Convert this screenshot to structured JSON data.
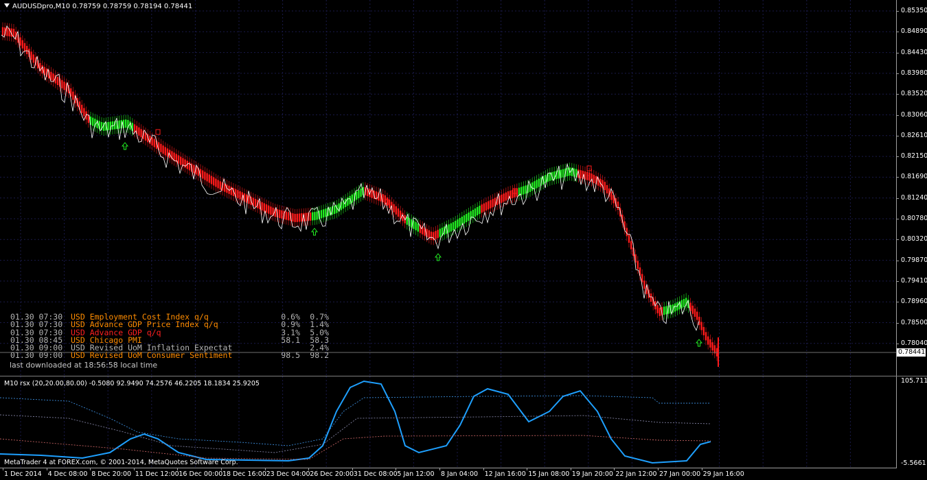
{
  "chart": {
    "symbol_title": "AUDUSDpro,M10  0.78759 0.78759 0.78194 0.78441",
    "current_price": "0.78441",
    "price_axis": [
      "0.85350",
      "0.84890",
      "0.84430",
      "0.83980",
      "0.83520",
      "0.83060",
      "0.82610",
      "0.82150",
      "0.81690",
      "0.81240",
      "0.80780",
      "0.80320",
      "0.79870",
      "0.79410",
      "0.78960",
      "0.78500",
      "0.78040"
    ],
    "time_axis": [
      "1 Dec 2014",
      "4 Dec 08:00",
      "8 Dec 20:00",
      "11 Dec 12:00",
      "16 Dec 00:00",
      "18 Dec 16:00",
      "23 Dec 04:00",
      "26 Dec 20:00",
      "31 Dec 08:00",
      "5 Jan 12:00",
      "8 Jan 04:00",
      "12 Jan 16:00",
      "15 Jan 08:00",
      "19 Jan 20:00",
      "22 Jan 12:00",
      "27 Jan 00:00",
      "29 Jan 16:00"
    ],
    "colors": {
      "background": "#000000",
      "grid": "#1a1a4a",
      "bear": "#ff1a1a",
      "bull": "#22ee22",
      "line": "#ffffff",
      "rsx": "#1ea0ff"
    }
  },
  "news": [
    {
      "time": "01.30 07:30",
      "event": "USD Employment Cost Index q/q",
      "actual": "0.6%",
      "forecast": "0.7%",
      "color": "#ff8c00"
    },
    {
      "time": "01.30 07:30",
      "event": "USD Advance GDP Price Index q/q",
      "actual": "0.9%",
      "forecast": "1.4%",
      "color": "#ff8c00"
    },
    {
      "time": "01.30 07:30",
      "event": "USD Advance GDP q/q",
      "actual": "3.1%",
      "forecast": "5.0%",
      "color": "#ff2020"
    },
    {
      "time": "01.30 08:45",
      "event": "USD Chicago PMI",
      "actual": "58.1",
      "forecast": "58.3",
      "color": "#ff8c00"
    },
    {
      "time": "01.30 09:00",
      "event": "USD Revised UoM Inflation Expectat",
      "actual": "",
      "forecast": "2.4%",
      "color": "#b4b4b4"
    },
    {
      "time": "01.30 09:00",
      "event": "USD Revised UoM Consumer Sentiment",
      "actual": "98.5",
      "forecast": "98.2",
      "color": "#ff8c00"
    }
  ],
  "last_downloaded": "last downloaded at 18:56:58 local time",
  "indicator": {
    "title": "M10 rsx (20,20.00,80.00) -0.5080 92.9490 74.2576 46.2205 18.1834 25.9205",
    "axis_top": "105.7119",
    "axis_bottom": "-5.5661"
  },
  "footer": "MetaTrader 4 at FOREX.com, © 2001-2014, MetaQuotes Software Corp."
}
